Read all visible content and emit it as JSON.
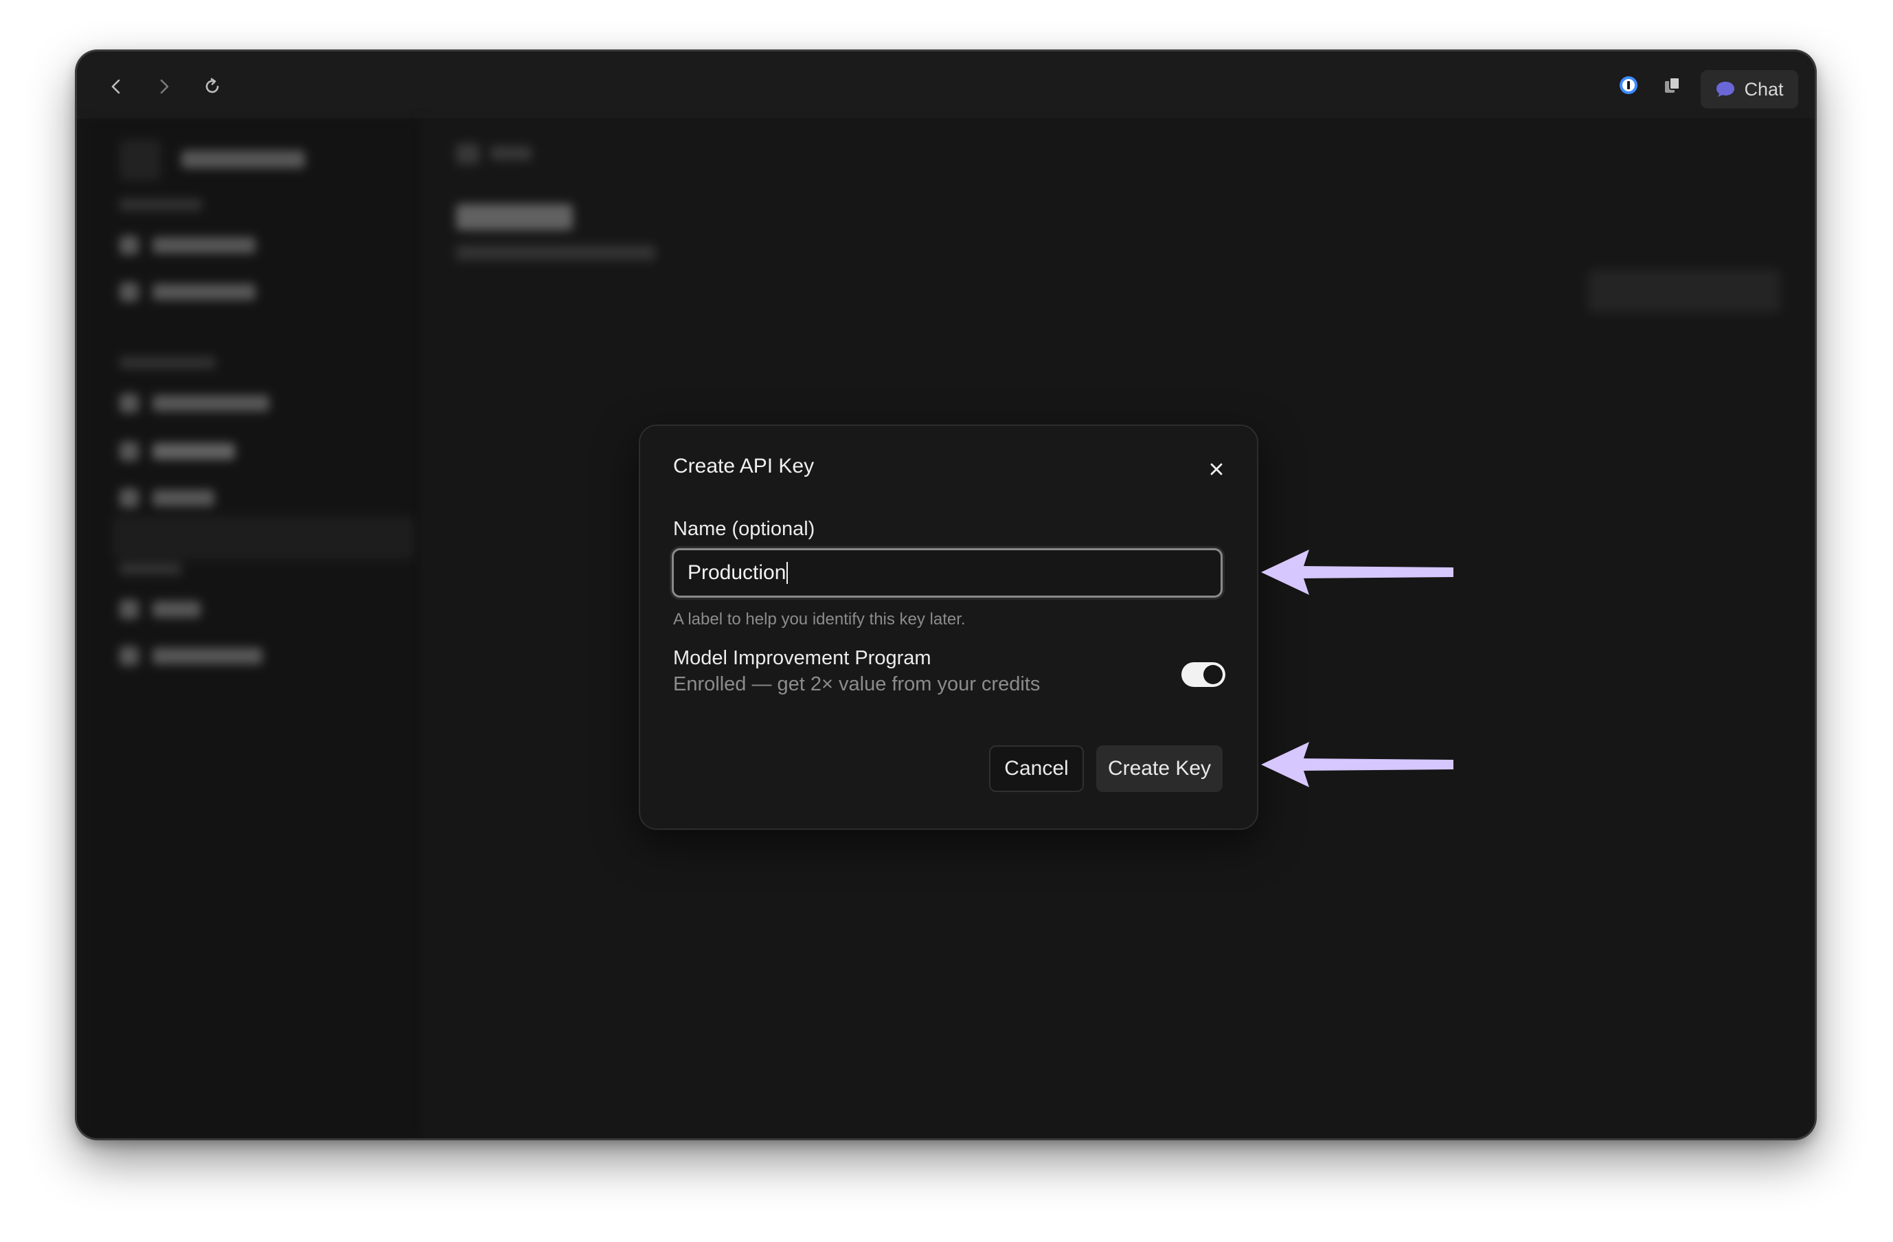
{
  "toolbar": {
    "chat_label": "Chat"
  },
  "dialog": {
    "title": "Create API Key",
    "name_label": "Name (optional)",
    "name_value": "Production",
    "name_hint": "A label to help you identify this key later.",
    "program_title": "Model Improvement Program",
    "program_subtitle": "Enrolled — get 2× value from your credits",
    "program_enabled": true,
    "cancel_label": "Cancel",
    "create_label": "Create Key"
  },
  "colors": {
    "arrow": "#d6c7ff",
    "onepassword_blue": "#3d8bff"
  }
}
